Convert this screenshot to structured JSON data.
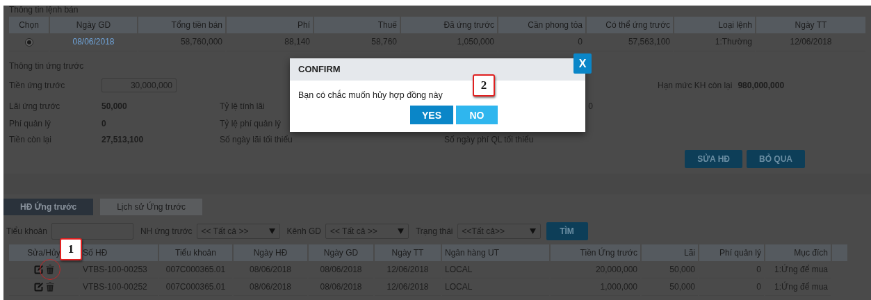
{
  "sell_orders": {
    "title": "Thông tin lệnh bán",
    "columns": [
      "Chọn",
      "Ngày GD",
      "Tổng tiền bán",
      "Phí",
      "Thuế",
      "Đã ứng trước",
      "Cần phong tỏa",
      "Có thể ứng trước",
      "Loại lệnh",
      "Ngày TT"
    ],
    "rows": [
      {
        "selected": true,
        "disabled": true,
        "cells": [
          "",
          "08/06/2018",
          "58,760,000",
          "88,140",
          "58,760",
          "1,050,000",
          "0",
          "57,563,100",
          "1:Thường",
          "12/06/2018"
        ]
      }
    ]
  },
  "advance_info": {
    "title": "Thông tin ứng trước",
    "amount_label": "Tiền ứng trước",
    "amount_value": "30,000,000",
    "limit_label": "Hạn mức KH còn lại",
    "limit_value": "980,000,000",
    "rows": [
      {
        "label": "Lãi ứng trước",
        "value": "50,000",
        "label_2": "Tỷ lệ tính lãi",
        "value_2": "0"
      },
      {
        "label": "Phí quản lý",
        "value": "0",
        "label_2": "Tỷ lệ phí quản lý"
      },
      {
        "label": "Tiền còn lại",
        "value": "27,513,100",
        "label_2": "Số ngày lãi tối thiểu",
        "label_3": "Số ngày phí QL tối thiểu"
      }
    ],
    "buttons": [
      "SỬA HĐ",
      "BỎ QUA"
    ]
  },
  "tabs": [
    {
      "label": "HĐ Ứng trước",
      "selected": true
    },
    {
      "label": "Lịch sử Ứng trước",
      "selected": false
    }
  ],
  "filters": [
    {
      "kind": "input",
      "label": "Tiểu khoản"
    },
    {
      "kind": "select",
      "label": "NH ứng trước",
      "value": "<< Tất cả >>"
    },
    {
      "kind": "select",
      "label": "Kênh GD",
      "value": "<< Tất cả >>"
    },
    {
      "kind": "select",
      "label": "Trạng thái",
      "value": "<<Tất cả>>"
    }
  ],
  "search_button": "TÌM",
  "contracts": {
    "columns": [
      "Sửa/Hủy",
      "Số HĐ",
      "Tiểu khoản",
      "Ngày HĐ",
      "Ngày GD",
      "Ngày TT",
      "Ngân hàng UT",
      "Tiền Ứng trước",
      "Lãi",
      "Phí quản lý",
      "Mục đích"
    ],
    "rows": [
      {
        "cells": [
          "",
          "VTBS-100-00253",
          "007C000365.01",
          "08/06/2018",
          "08/06/2018",
          "12/06/2018",
          "LOCAL",
          "20,000,000",
          "50,000",
          "0",
          "1:Ứng để mua"
        ]
      },
      {
        "cells": [
          "",
          "VTBS-100-00252",
          "007C000365.01",
          "08/06/2018",
          "08/06/2018",
          "12/06/2018",
          "LOCAL",
          "1,000,000",
          "50,000",
          "0",
          "1:Ứng để mua"
        ]
      }
    ]
  },
  "dialog": {
    "title": "CONFIRM",
    "close": "X",
    "message": "Bạn có chắc muốn hủy hợp đồng này",
    "buttons": [
      {
        "label": "YES",
        "kind": "primary"
      },
      {
        "label": "NO",
        "kind": "secondary"
      }
    ]
  },
  "callouts": [
    "1",
    "2"
  ]
}
